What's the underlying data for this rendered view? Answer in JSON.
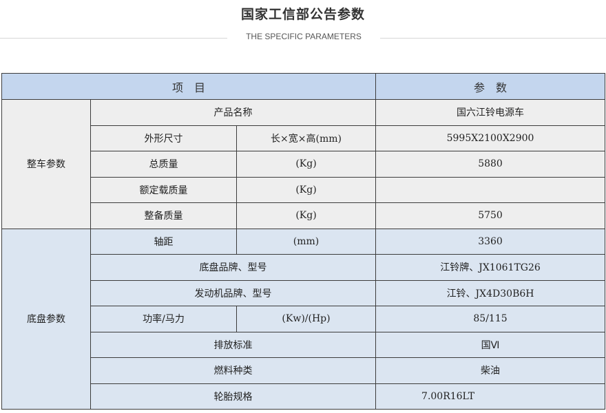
{
  "header": {
    "title": "国家工信部公告参数",
    "subtitle": "THE SPECIFIC PARAMETERS"
  },
  "table": {
    "col_item": "项　目",
    "col_param": "参　数",
    "group1": {
      "label": "整车参数",
      "rows": [
        {
          "name": "产品名称",
          "unit": "",
          "value": "国六江铃电源车"
        },
        {
          "name": "外形尺寸",
          "unit": "长×宽×高(mm)",
          "value": "5995X2100X2900"
        },
        {
          "name": "总质量",
          "unit": "(Kg)",
          "value": "5880"
        },
        {
          "name": "额定载质量",
          "unit": "(Kg)",
          "value": ""
        },
        {
          "name": "整备质量",
          "unit": "(Kg)",
          "value": "5750"
        }
      ]
    },
    "group2": {
      "label": "底盘参数",
      "rows": [
        {
          "name": "轴距",
          "unit": "(mm)",
          "value": "3360"
        },
        {
          "name": "底盘品牌、型号",
          "unit": "",
          "value": "江铃牌、JX1061TG26"
        },
        {
          "name": "发动机品牌、型号",
          "unit": "",
          "value": "江铃、JX4D30B6H"
        },
        {
          "name": "功率/马力",
          "unit": "(Kw)/(Hp)",
          "value": "85/115"
        },
        {
          "name": "排放标准",
          "unit": "",
          "value": "国Ⅵ"
        },
        {
          "name": "燃料种类",
          "unit": "",
          "value": "柴油"
        },
        {
          "name": "轮胎规格",
          "unit": "",
          "value": "7.00R16LT"
        }
      ]
    }
  },
  "colors": {
    "header_bg": "#c4d6ee",
    "group1_bg": "#eeeeee",
    "group2_bg": "#dbe5f1",
    "border": "#3b3b3b"
  }
}
